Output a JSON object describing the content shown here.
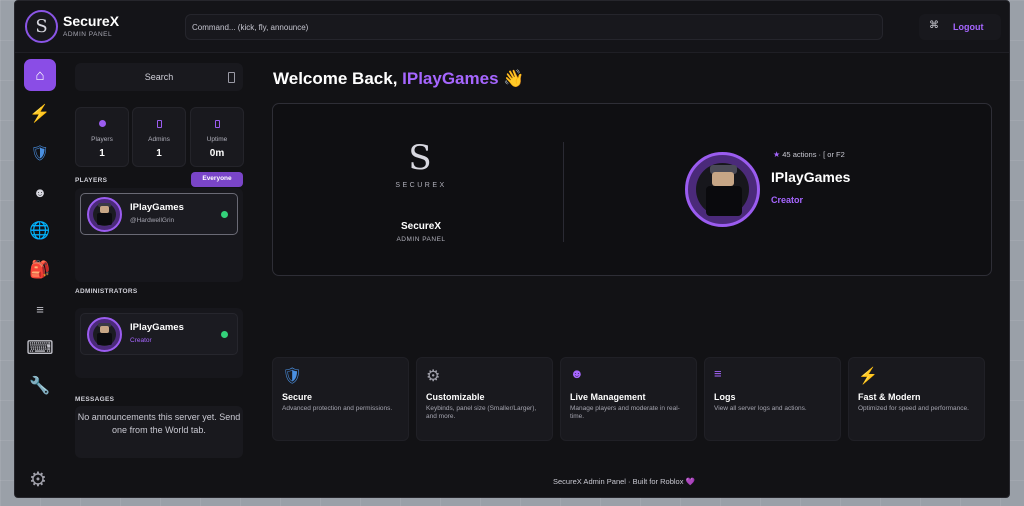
{
  "header": {
    "app_name": "SecureX",
    "app_sub": "ADMIN PANEL",
    "logo_glyph": "S",
    "command_placeholder": "Command... (kick, fly, announce)",
    "logout_label": "Logout",
    "cmd_icon": "⌘"
  },
  "sidebar": {
    "items": [
      {
        "icon": "home-icon",
        "glyph": "⌂"
      },
      {
        "icon": "lightning-icon",
        "glyph": "⚡"
      },
      {
        "icon": "shield-icon",
        "glyph": "🛡"
      },
      {
        "icon": "face-icon",
        "glyph": "☻"
      },
      {
        "icon": "globe-icon",
        "glyph": "🌐"
      },
      {
        "icon": "backpack-icon",
        "glyph": "🎒"
      },
      {
        "icon": "list-icon",
        "glyph": "≡"
      },
      {
        "icon": "keyboard-icon",
        "glyph": "⌨"
      },
      {
        "icon": "wrench-icon",
        "glyph": "🔧"
      }
    ],
    "settings_glyph": "⚙"
  },
  "left": {
    "search_label": "Search",
    "stats": [
      {
        "label": "Players",
        "value": "1"
      },
      {
        "label": "Admins",
        "value": "1"
      },
      {
        "label": "Uptime",
        "value": "0m"
      }
    ],
    "players_label": "PLAYERS",
    "everyone_label": "Everyone",
    "players": [
      {
        "name": "IPlayGames",
        "sub": "@HardwellGrin"
      }
    ],
    "admins_label": "ADMINISTRATORS",
    "admins": [
      {
        "name": "IPlayGames",
        "role": "Creator"
      }
    ],
    "messages_label": "MESSAGES",
    "messages_text": "No announcements this server yet. Send one from the World tab."
  },
  "main": {
    "welcome_prefix": "Welcome Back, ",
    "welcome_name": "IPlayGames",
    "welcome_emoji": "👋",
    "hero": {
      "logo_glyph": "S",
      "logo_text": "SECUREX",
      "brand_name": "SecureX",
      "brand_sub": "ADMIN PANEL",
      "meta": "45 actions · [ or F2",
      "star": "★",
      "username": "IPlayGames",
      "role": "Creator"
    },
    "features": [
      {
        "icon": "shield-icon",
        "glyph": "🛡",
        "title": "Secure",
        "desc": "Advanced protection and permissions."
      },
      {
        "icon": "gear-icon",
        "glyph": "⚙",
        "title": "Customizable",
        "desc": "Keybinds, panel size (Smaller/Larger), and more."
      },
      {
        "icon": "face-icon",
        "glyph": "☻",
        "title": "Live Management",
        "desc": "Manage players and moderate in real-time."
      },
      {
        "icon": "list-icon",
        "glyph": "≡",
        "title": "Logs",
        "desc": "View all server logs and actions."
      },
      {
        "icon": "lightning-icon",
        "glyph": "⚡",
        "title": "Fast & Modern",
        "desc": "Optimized for speed and performance."
      }
    ],
    "footer": "SecureX Admin Panel · Built for Roblox",
    "footer_heart": "💜"
  },
  "colors": {
    "accent": "#9b5cf0",
    "background": "#121215",
    "online": "#33d17a"
  }
}
